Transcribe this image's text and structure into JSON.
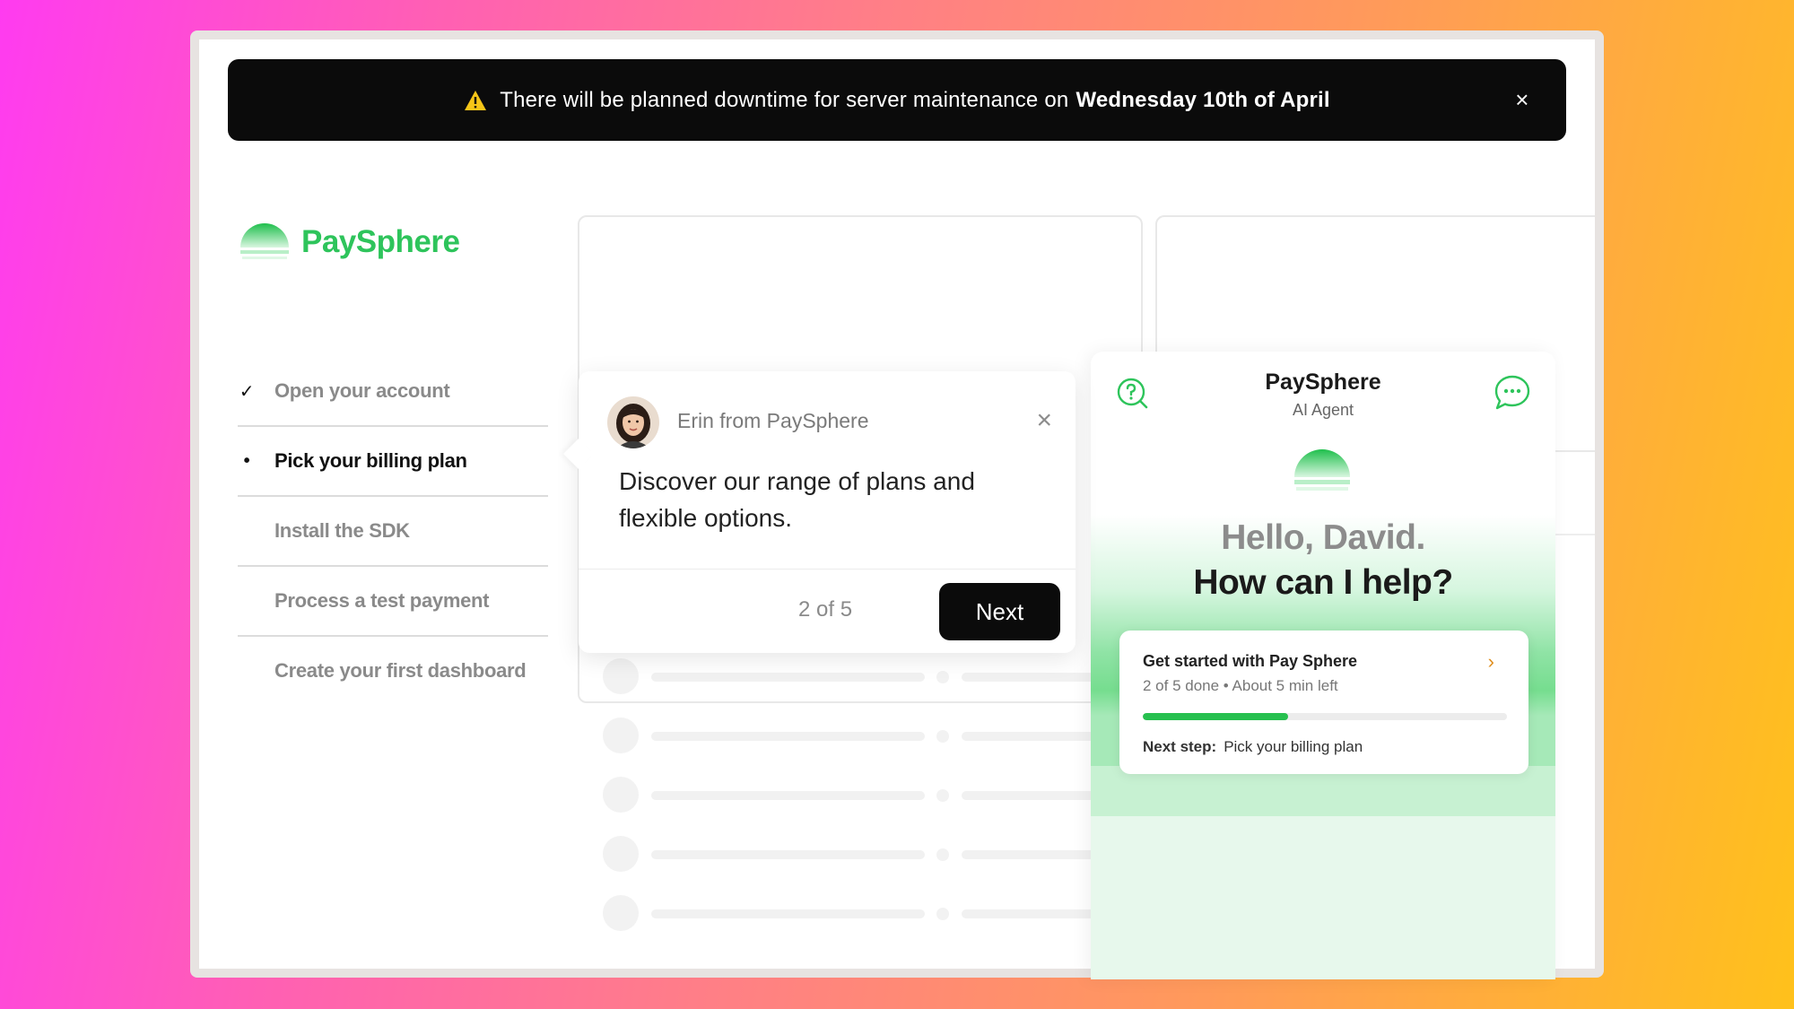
{
  "banner": {
    "message": "There will be planned downtime for server maintenance on",
    "date": "Wednesday 10th of April",
    "warning_icon": "warning-triangle-icon",
    "close_icon": "close-icon",
    "close_glyph": "×"
  },
  "brand": {
    "name": "PaySphere",
    "color": "#2ec45b"
  },
  "steps": [
    {
      "label": "Open your account",
      "state": "done",
      "mark": "✓"
    },
    {
      "label": "Pick your billing plan",
      "state": "current",
      "mark": "•"
    },
    {
      "label": "Install the SDK",
      "state": "pending",
      "mark": ""
    },
    {
      "label": "Process a test payment",
      "state": "pending",
      "mark": ""
    },
    {
      "label": "Create your first dashboard",
      "state": "pending",
      "mark": ""
    }
  ],
  "tooltip": {
    "sender": "Erin from PaySphere",
    "close_glyph": "×",
    "body": "Discover our range of plans and flexible options.",
    "count": "2 of 5",
    "next_label": "Next"
  },
  "agent": {
    "title": "PaySphere",
    "subtitle": "AI Agent",
    "greeting": "Hello, David.",
    "prompt": "How can I help?",
    "help_icon": "question-circle-icon",
    "chat_icon": "chat-bubble-icon",
    "getting_started": {
      "title": "Get started with Pay Sphere",
      "meta": "2 of 5 done • About 5 min left",
      "progress_fraction": 0.4,
      "next_step_label": "Next step:",
      "next_step_value": "Pick your billing plan",
      "chevron": "›"
    }
  },
  "colors": {
    "accent_green": "#27c04f",
    "banner_bg": "#0b0b0b",
    "warning": "#f5c518"
  }
}
